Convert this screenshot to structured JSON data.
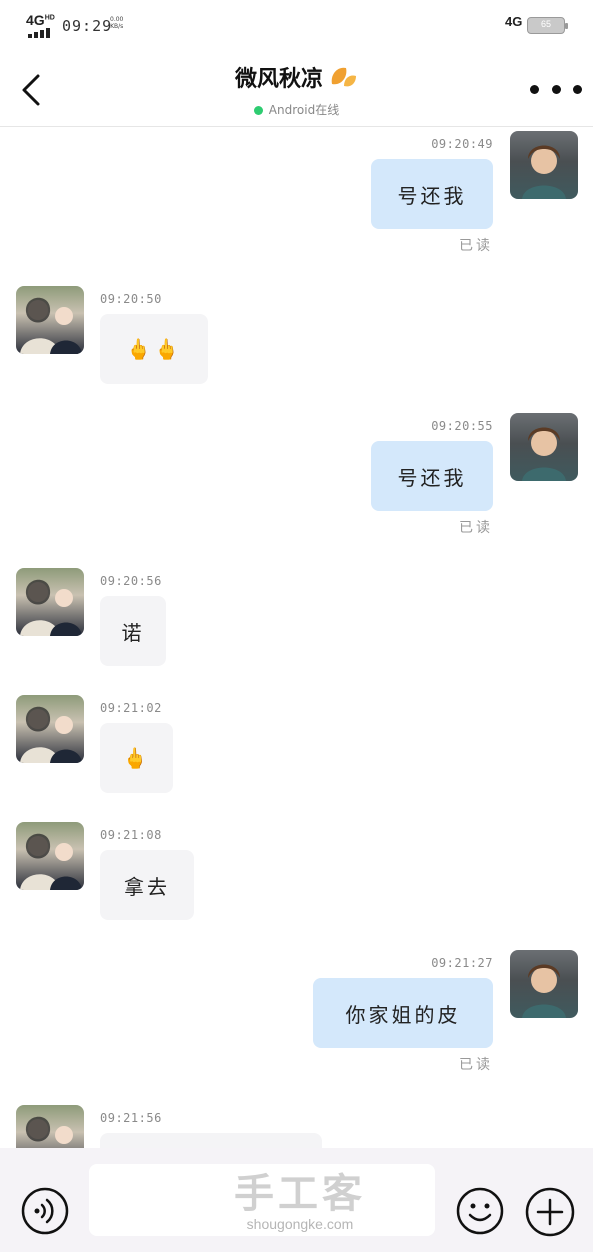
{
  "status_bar": {
    "network_left": "4G",
    "network_left_suffix": "HD",
    "time": "09:29",
    "speed_value": "0.00",
    "speed_unit": "KB/s",
    "network_right": "4G",
    "battery": "65"
  },
  "header": {
    "title": "微风秋凉",
    "status": "Android在线",
    "status_color": "#2ecc71"
  },
  "messages": [
    {
      "side": "out",
      "time": "09:20:49",
      "text": "号还我",
      "read": "已读"
    },
    {
      "side": "in",
      "time": "09:20:50",
      "text": "🖕🖕"
    },
    {
      "side": "out",
      "time": "09:20:55",
      "text": "号还我",
      "read": "已读"
    },
    {
      "side": "in",
      "time": "09:20:56",
      "text": "诺"
    },
    {
      "side": "in",
      "time": "09:21:02",
      "text": "🖕"
    },
    {
      "side": "in",
      "time": "09:21:08",
      "text": "拿去"
    },
    {
      "side": "out",
      "time": "09:21:27",
      "text": "你家姐的皮",
      "read": "已读"
    },
    {
      "side": "in",
      "time": "09:21:56",
      "text": ""
    }
  ],
  "watermark": {
    "cn": "手工客",
    "en": "shougongke.com"
  },
  "colors": {
    "out_bubble": "#d4e8fb",
    "in_bubble": "#f4f4f6",
    "input_bar": "#f5f3f7"
  }
}
